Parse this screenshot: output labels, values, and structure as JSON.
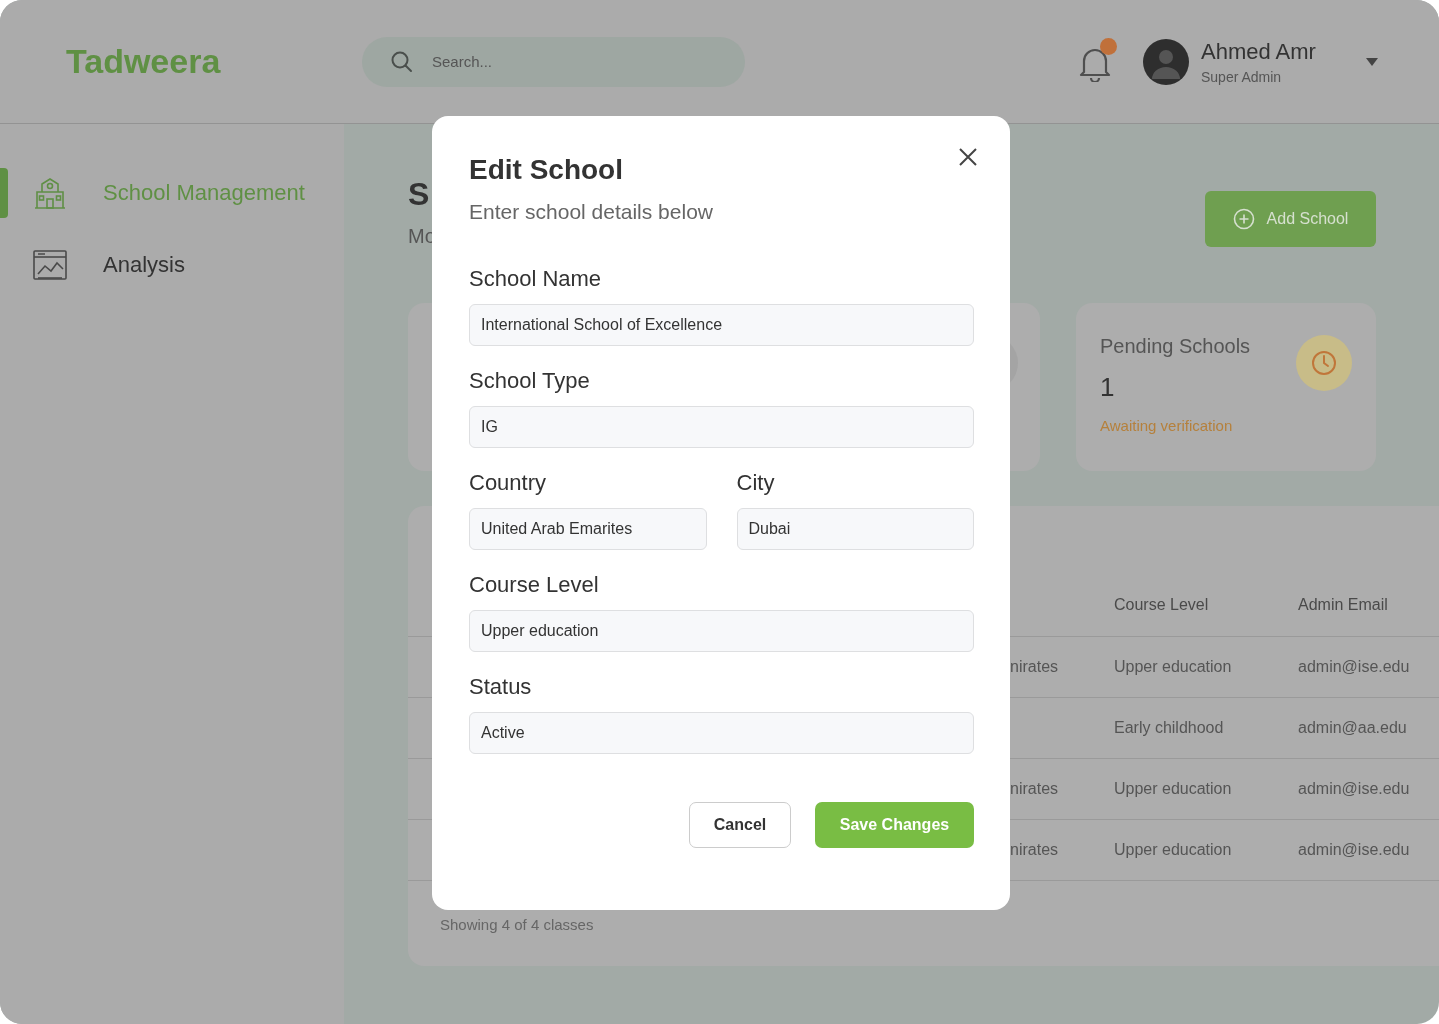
{
  "header": {
    "logo": "Tadweera",
    "search": {
      "placeholder": "Search..."
    },
    "notifications": {
      "unread": true
    },
    "user": {
      "name": "Ahmed Amr",
      "role": "Super Admin"
    }
  },
  "sidebar": {
    "items": [
      {
        "label": "School Management",
        "kind": "school",
        "selected": true
      },
      {
        "label": "Analysis",
        "kind": "chart",
        "selected": false
      }
    ]
  },
  "page": {
    "title": "S",
    "subtitle": "Mo",
    "add_button": "Add School"
  },
  "pending_card": {
    "title": "Pending Schools",
    "value": "1",
    "note": "Awaiting verification"
  },
  "table": {
    "columns": [
      "Course Level",
      "Admin Email"
    ],
    "rows": [
      {
        "column_1": "nirates",
        "course_level": "Upper education",
        "admin_email": "admin@ise.edu"
      },
      {
        "course_level": "Early childhood",
        "admin_email": "admin@aa.edu"
      },
      {
        "column_1": "nirates",
        "course_level": "Upper education",
        "admin_email": "admin@ise.edu"
      },
      {
        "column_1": "nirates",
        "course_level": "Upper education",
        "admin_email": "admin@ise.edu"
      }
    ],
    "footer": "Showing 4 of 4 classes"
  },
  "modal": {
    "title": "Edit School",
    "subtitle": "Enter school details below",
    "fields": [
      {
        "kind": "full",
        "label": "School Name",
        "value": "International School of Excellence"
      },
      {
        "kind": "full",
        "label": "School Type",
        "value": "IG"
      },
      {
        "kind": "half",
        "label": "Country",
        "value": "United Arab Emarites"
      },
      {
        "kind": "half",
        "label": "City",
        "value": "Dubai"
      },
      {
        "kind": "full",
        "label": "Course Level",
        "value": "Upper education"
      },
      {
        "kind": "full",
        "label": "Status",
        "value": "Active"
      }
    ],
    "buttons": [
      {
        "kind": "secondary",
        "label": "Cancel"
      },
      {
        "kind": "primary",
        "label": "Save Changes"
      }
    ]
  }
}
